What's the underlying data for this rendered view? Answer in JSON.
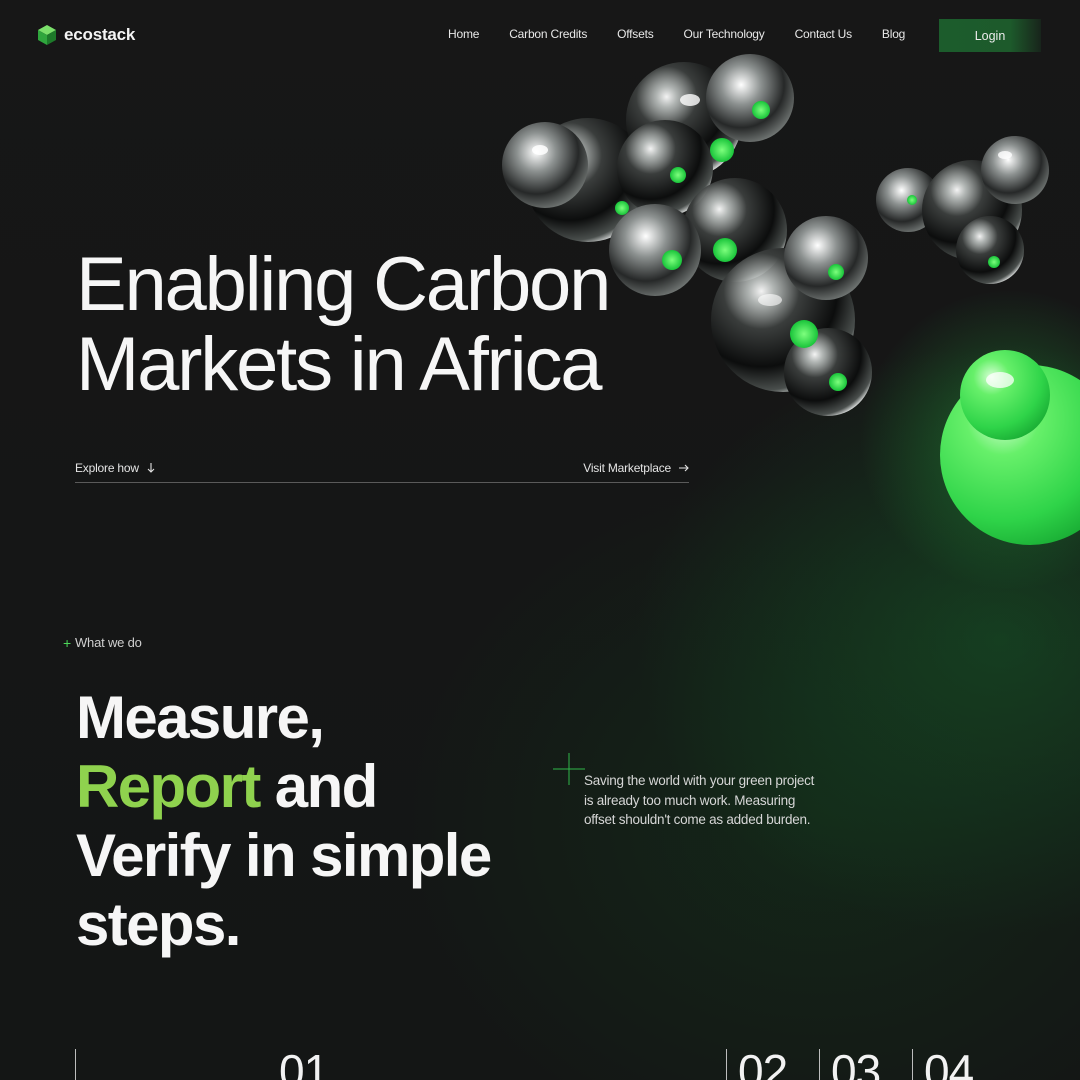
{
  "brand": {
    "name": "ecostack",
    "accent": "#4cd85a",
    "accent_text": "#8fd24e",
    "button_bg": "#1c5c2c"
  },
  "nav": {
    "items": [
      {
        "label": "Home"
      },
      {
        "label": "Carbon Credits"
      },
      {
        "label": "Offsets"
      },
      {
        "label": "Our Technology"
      },
      {
        "label": "Contact Us"
      },
      {
        "label": "Blog"
      }
    ],
    "login_label": "Login"
  },
  "hero": {
    "title_line1": "Enabling Carbon",
    "title_line2": "Markets in Africa",
    "explore_label": "Explore how",
    "explore_icon": "arrow-down-icon",
    "marketplace_label": "Visit Marketplace",
    "marketplace_icon": "arrow-right-icon"
  },
  "what_we_do": {
    "tag": "What we do",
    "heading_part1": "Measure,",
    "heading_accent": "Report",
    "heading_part2": " and",
    "heading_line3": "Verify in simple",
    "heading_line4": "steps.",
    "blurb": "Saving the world with your green project is already too much work. Measuring offset shouldn't come as added burden."
  },
  "steps": {
    "items": [
      {
        "number": "01"
      },
      {
        "number": "02"
      },
      {
        "number": "03"
      },
      {
        "number": "04"
      }
    ]
  }
}
